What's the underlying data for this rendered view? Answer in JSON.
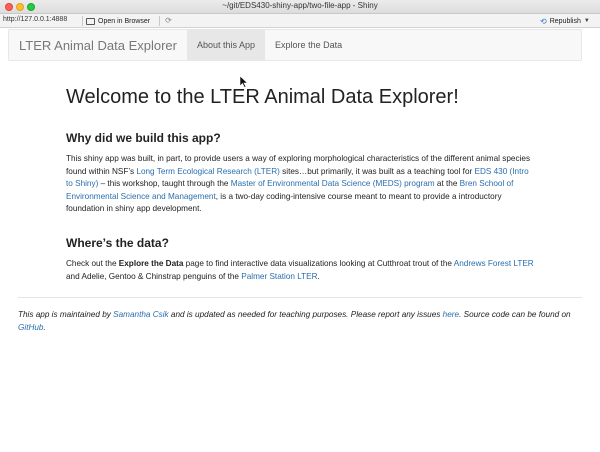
{
  "window": {
    "title": "~/git/EDS430-shiny-app/two-file-app - Shiny"
  },
  "toolbar": {
    "url": "http://127.0.0.1:4888",
    "open_in_browser": "Open in Browser",
    "republish": "Republish"
  },
  "navbar": {
    "brand": "LTER Animal Data Explorer",
    "tabs": [
      {
        "label": "About this App",
        "active": true
      },
      {
        "label": "Explore the Data",
        "active": false
      }
    ]
  },
  "main": {
    "heading": "Welcome to the LTER Animal Data Explorer!",
    "why": {
      "title": "Why did we build this app?",
      "p1": "This shiny app was built, in part, to provide users a way of exploring morphological characteristics of the different animal species found within NSF’s ",
      "l1": "Long Term Ecological Research (LTER)",
      "p2": " sites…but primarily, it was built as a teaching tool for ",
      "l2": "EDS 430 (Intro to Shiny)",
      "p3": " – this workshop, taught through the ",
      "l3": "Master of Environmental Data Science (MEDS) program",
      "p4": " at the ",
      "l4": "Bren School of Environmental Science and Management",
      "p5": ", is a two-day coding-intensive course meant to meant to provide a introductory foundation in shiny app development."
    },
    "where": {
      "title": "Where’s the data?",
      "p1": "Check out the ",
      "bold": "Explore the Data",
      "p2": " page to find interactive data visualizations looking at Cutthroat trout of the ",
      "l1": "Andrews Forest LTER",
      "p3": " and Adelie, Gentoo & Chinstrap penguins of the ",
      "l2": "Palmer Station LTER",
      "p4": "."
    }
  },
  "footer": {
    "p1": "This app is maintained by ",
    "l1": "Samantha Csik",
    "p2": " and is updated as needed for teaching purposes. Please report any issues ",
    "l2": "here",
    "p3": ". Source code can be found on ",
    "l3": "GitHub",
    "p4": "."
  },
  "icons": {
    "open_in_browser": "browser-window-icon",
    "refresh": "refresh-icon",
    "republish": "republish-icon"
  },
  "colors": {
    "link": "#2a6ead",
    "active_tab": "#e7e7e7"
  }
}
